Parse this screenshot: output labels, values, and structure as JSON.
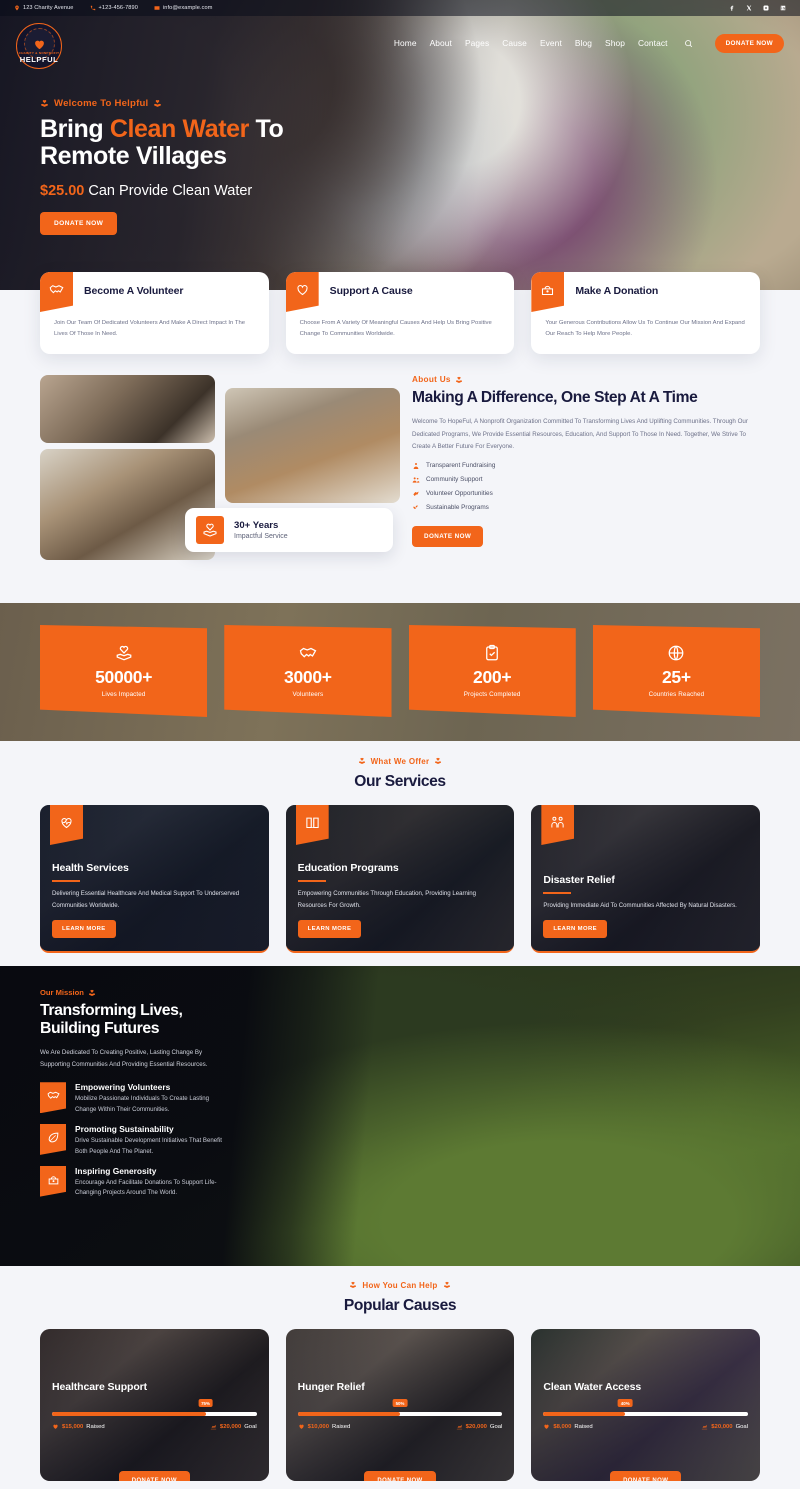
{
  "topbar": {
    "address": "123 Charity Avenue",
    "phone": "+123-456-7890",
    "email": "info@example.com",
    "socials": [
      "facebook-icon",
      "x-icon",
      "instagram-icon",
      "linkedin-icon"
    ]
  },
  "header": {
    "logo_text": "HELPFUL",
    "logo_sub": "CHARITY & NONPROFIT",
    "menu": [
      "Home",
      "About",
      "Pages",
      "Cause",
      "Event",
      "Blog",
      "Shop",
      "Contact"
    ],
    "search_icon": "search-icon",
    "donate_label": "DONATE NOW"
  },
  "hero": {
    "eyebrow": "Welcome To Helpful",
    "title_1": "Bring ",
    "title_accent": "Clean Water",
    "title_2": " To",
    "title_line2": "Remote Villages",
    "price": "$25.00",
    "price_rest": "Can Provide Clean Water",
    "cta": "DONATE NOW"
  },
  "features": [
    {
      "icon": "handshake-icon",
      "title": "Become A Volunteer",
      "desc": "Join Our Team Of Dedicated Volunteers And Make A Direct Impact In The Lives Of Those In Need."
    },
    {
      "icon": "heart-icon",
      "title": "Support A Cause",
      "desc": "Choose From A Variety Of Meaningful Causes And Help Us Bring Positive Change To Communities Worldwide."
    },
    {
      "icon": "donation-box-icon",
      "title": "Make A Donation",
      "desc": "Your Generous Contributions Allow Us To Continue Our Mission And Expand Our Reach To Help More People."
    }
  ],
  "about": {
    "eyebrow": "About Us",
    "title": "Making A Difference, One Step At A Time",
    "paragraph": "Welcome To HopeFul, A Nonprofit Organization Committed To Transforming Lives And Uplifting Communities. Through Our Dedicated Programs, We Provide Essential Resources, Education, And Support To Those In Need. Together, We Strive To Create A Better Future For Everyone.",
    "list": [
      "Transparent Fundraising",
      "Community Support",
      "Volunteer Opportunities",
      "Sustainable Programs"
    ],
    "cta": "DONATE NOW",
    "badge_number": "30+ Years",
    "badge_label": "Impactful Service"
  },
  "stats": [
    {
      "icon": "hand-heart-icon",
      "number": "50000+",
      "label": "Lives Impacted"
    },
    {
      "icon": "handshake-icon",
      "number": "3000+",
      "label": "Volunteers"
    },
    {
      "icon": "clipboard-check-icon",
      "number": "200+",
      "label": "Projects Completed"
    },
    {
      "icon": "globe-icon",
      "number": "25+",
      "label": "Countries Reached"
    }
  ],
  "services": {
    "eyebrow": "What We Offer",
    "title": "Our Services",
    "items": [
      {
        "icon": "heart-pulse-icon",
        "title": "Health Services",
        "desc": "Delivering Essential Healthcare And Medical Support To Underserved Communities Worldwide.",
        "cta": "LEARN MORE"
      },
      {
        "icon": "book-icon",
        "title": "Education Programs",
        "desc": "Empowering Communities Through Education, Providing Learning Resources For Growth.",
        "cta": "LEARN MORE"
      },
      {
        "icon": "people-support-icon",
        "title": "Disaster Relief",
        "desc": "Providing Immediate Aid To Communities Affected By Natural Disasters.",
        "cta": "LEARN MORE"
      }
    ]
  },
  "mission": {
    "eyebrow": "Our Mission",
    "title_l1": "Transforming Lives,",
    "title_l2": "Building Futures",
    "paragraph": "We Are Dedicated To Creating Positive, Lasting Change By Supporting Communities And Providing Essential Resources.",
    "items": [
      {
        "icon": "handshake-icon",
        "title": "Empowering Volunteers",
        "desc": "Mobilize Passionate Individuals To Create Lasting Change Within Their Communities."
      },
      {
        "icon": "leaf-icon",
        "title": "Promoting Sustainability",
        "desc": "Drive Sustainable Development Initiatives That Benefit Both People And The Planet."
      },
      {
        "icon": "donation-box-icon",
        "title": "Inspiring Generosity",
        "desc": "Encourage And Facilitate Donations To Support Life-Changing Projects Around The World."
      }
    ]
  },
  "causes": {
    "eyebrow": "How You Can Help",
    "title": "Popular Causes",
    "items": [
      {
        "title": "Healthcare Support",
        "percent": "75%",
        "percent_value": 75,
        "raised": "$15,000",
        "raised_label": "Raised",
        "goal": "$20,000",
        "goal_label": "Goal",
        "cta": "DONATE NOW"
      },
      {
        "title": "Hunger Relief",
        "percent": "50%",
        "percent_value": 50,
        "raised": "$10,000",
        "raised_label": "Raised",
        "goal": "$20,000",
        "goal_label": "Goal",
        "cta": "DONATE NOW"
      },
      {
        "title": "Clean Water Access",
        "percent": "40%",
        "percent_value": 40,
        "raised": "$8,000",
        "raised_label": "Raised",
        "goal": "$20,000",
        "goal_label": "Goal",
        "cta": "DONATE NOW"
      }
    ]
  },
  "colors": {
    "accent": "#f2651a",
    "navy": "#191a3e",
    "page_bg": "#f4f5f9"
  }
}
